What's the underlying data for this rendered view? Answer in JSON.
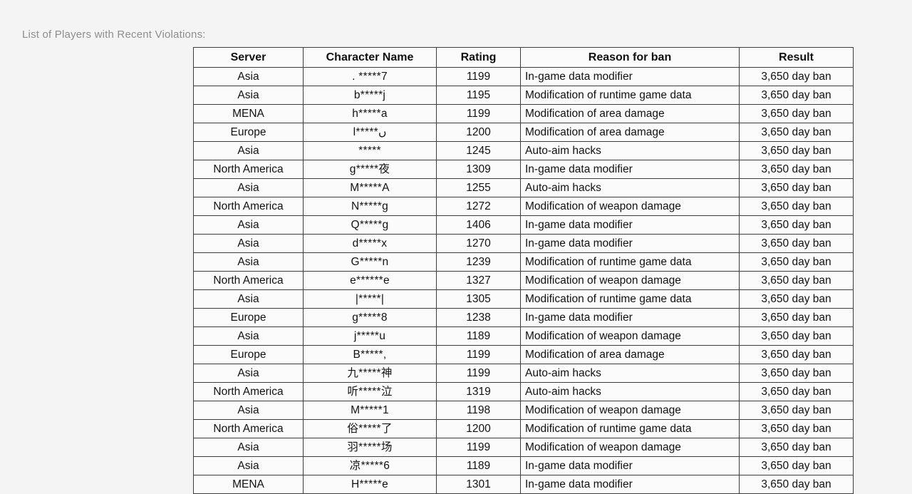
{
  "heading": "List of Players with Recent Violations:",
  "table": {
    "columns": [
      {
        "key": "server",
        "label": "Server"
      },
      {
        "key": "name",
        "label": "Character Name"
      },
      {
        "key": "rating",
        "label": "Rating"
      },
      {
        "key": "reason",
        "label": "Reason for ban"
      },
      {
        "key": "result",
        "label": "Result"
      }
    ],
    "rows": [
      {
        "server": "Asia",
        "name": ". *****7",
        "rating": "1199",
        "reason": "In-game data modifier",
        "result": "3,650 day ban"
      },
      {
        "server": "Asia",
        "name": "b*****j",
        "rating": "1195",
        "reason": "Modification of runtime game data",
        "result": "3,650 day ban"
      },
      {
        "server": "MENA",
        "name": "h*****a",
        "rating": "1199",
        "reason": "Modification of area damage",
        "result": "3,650 day ban"
      },
      {
        "server": "Europe",
        "name": "l*****ں",
        "rating": "1200",
        "reason": "Modification of area damage",
        "result": "3,650 day ban"
      },
      {
        "server": "Asia",
        "name": "*****",
        "rating": "1245",
        "reason": "Auto-aim hacks",
        "result": "3,650 day ban"
      },
      {
        "server": "North America",
        "name": "g*****夜",
        "rating": "1309",
        "reason": "In-game data modifier",
        "result": "3,650 day ban"
      },
      {
        "server": "Asia",
        "name": "M*****A",
        "rating": "1255",
        "reason": "Auto-aim hacks",
        "result": "3,650 day ban"
      },
      {
        "server": "North America",
        "name": "N*****g",
        "rating": "1272",
        "reason": "Modification of weapon damage",
        "result": "3,650 day ban"
      },
      {
        "server": "Asia",
        "name": "Q*****g",
        "rating": "1406",
        "reason": "In-game data modifier",
        "result": "3,650 day ban"
      },
      {
        "server": "Asia",
        "name": "d*****x",
        "rating": "1270",
        "reason": "In-game data modifier",
        "result": "3,650 day ban"
      },
      {
        "server": "Asia",
        "name": "G*****n",
        "rating": "1239",
        "reason": "Modification of runtime game data",
        "result": "3,650 day ban"
      },
      {
        "server": "North America",
        "name": "e******e",
        "rating": "1327",
        "reason": "Modification of weapon damage",
        "result": "3,650 day ban"
      },
      {
        "server": "Asia",
        "name": "|*****|",
        "rating": "1305",
        "reason": "Modification of runtime game data",
        "result": "3,650 day ban"
      },
      {
        "server": "Europe",
        "name": "g*****8",
        "rating": "1238",
        "reason": "In-game data modifier",
        "result": "3,650 day ban"
      },
      {
        "server": "Asia",
        "name": "j*****u",
        "rating": "1189",
        "reason": "Modification of weapon damage",
        "result": "3,650 day ban"
      },
      {
        "server": "Europe",
        "name": "B*****,",
        "rating": "1199",
        "reason": "Modification of area damage",
        "result": "3,650 day ban"
      },
      {
        "server": "Asia",
        "name": "九*****神",
        "rating": "1199",
        "reason": "Auto-aim hacks",
        "result": "3,650 day ban"
      },
      {
        "server": "North America",
        "name": "听*****泣",
        "rating": "1319",
        "reason": "Auto-aim hacks",
        "result": "3,650 day ban"
      },
      {
        "server": "Asia",
        "name": "M*****1",
        "rating": "1198",
        "reason": "Modification of weapon damage",
        "result": "3,650 day ban"
      },
      {
        "server": "North America",
        "name": "俗*****了",
        "rating": "1200",
        "reason": "Modification of runtime game data",
        "result": "3,650 day ban"
      },
      {
        "server": "Asia",
        "name": "羽*****场",
        "rating": "1199",
        "reason": "Modification of weapon damage",
        "result": "3,650 day ban"
      },
      {
        "server": "Asia",
        "name": "凉*****6",
        "rating": "1189",
        "reason": "In-game data modifier",
        "result": "3,650 day ban"
      },
      {
        "server": "MENA",
        "name": "H*****e",
        "rating": "1301",
        "reason": "In-game data modifier",
        "result": "3,650 day ban"
      }
    ]
  }
}
